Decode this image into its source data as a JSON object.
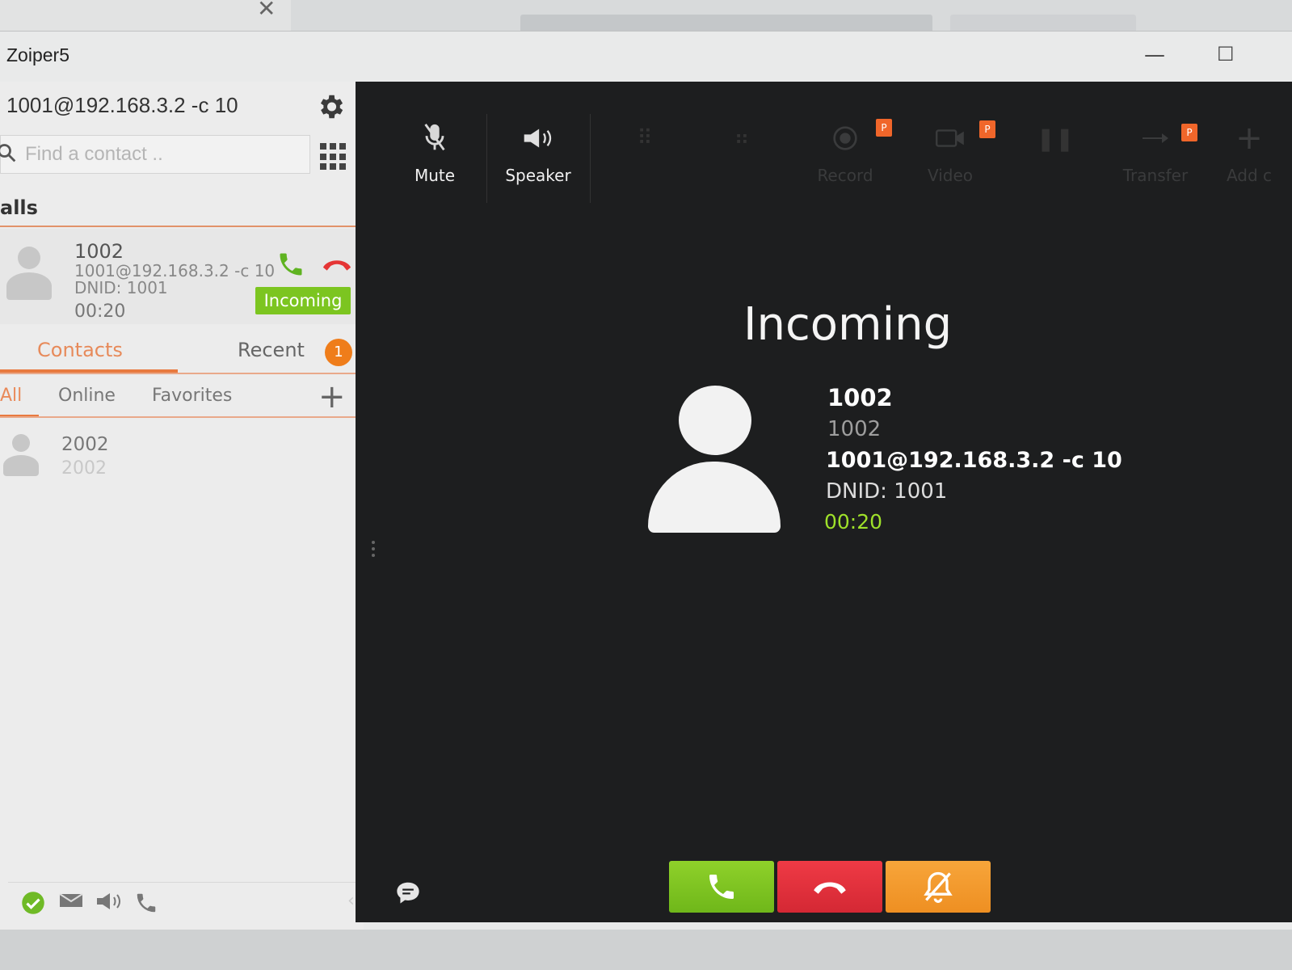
{
  "app": {
    "title": "Zoiper5"
  },
  "sidebar": {
    "account": "1001@192.168.3.2 -c 10",
    "search_placeholder": "Find a contact ..",
    "calls_header": "alls",
    "active_call": {
      "name": "1002",
      "account": "1001@192.168.3.2 -c 10",
      "dnid": "DNID: 1001",
      "timer": "00:20",
      "status": "Incoming"
    },
    "tabs": {
      "contacts": "Contacts",
      "recent": "Recent",
      "recent_count": "1"
    },
    "filters": {
      "all": "All",
      "online": "Online",
      "favorites": "Favorites"
    },
    "contacts": [
      {
        "name": "2002",
        "number": "2002"
      }
    ]
  },
  "toolbar": {
    "mute": "Mute",
    "speaker": "Speaker",
    "record": "Record",
    "video": "Video",
    "transfer": "Transfer",
    "add": "Add c",
    "pro_badge": "P"
  },
  "call_screen": {
    "state": "Incoming",
    "caller_name": "1002",
    "caller_number": "1002",
    "account": "1001@192.168.3.2 -c 10",
    "dnid": "DNID: 1001",
    "timer": "00:20"
  },
  "colors": {
    "accent": "#e87a3f",
    "answer": "#7cc520",
    "reject": "#e2303c",
    "silence": "#f39a2c",
    "timer": "#9fe12a",
    "panel_bg": "#1d1e1f"
  },
  "icons": {
    "settings": "gear-icon",
    "search": "search-icon",
    "dialpad": "dialpad-icon",
    "answer": "phone-icon",
    "reject": "hangup-icon",
    "silence": "bell-off-icon",
    "chat": "chat-icon"
  }
}
